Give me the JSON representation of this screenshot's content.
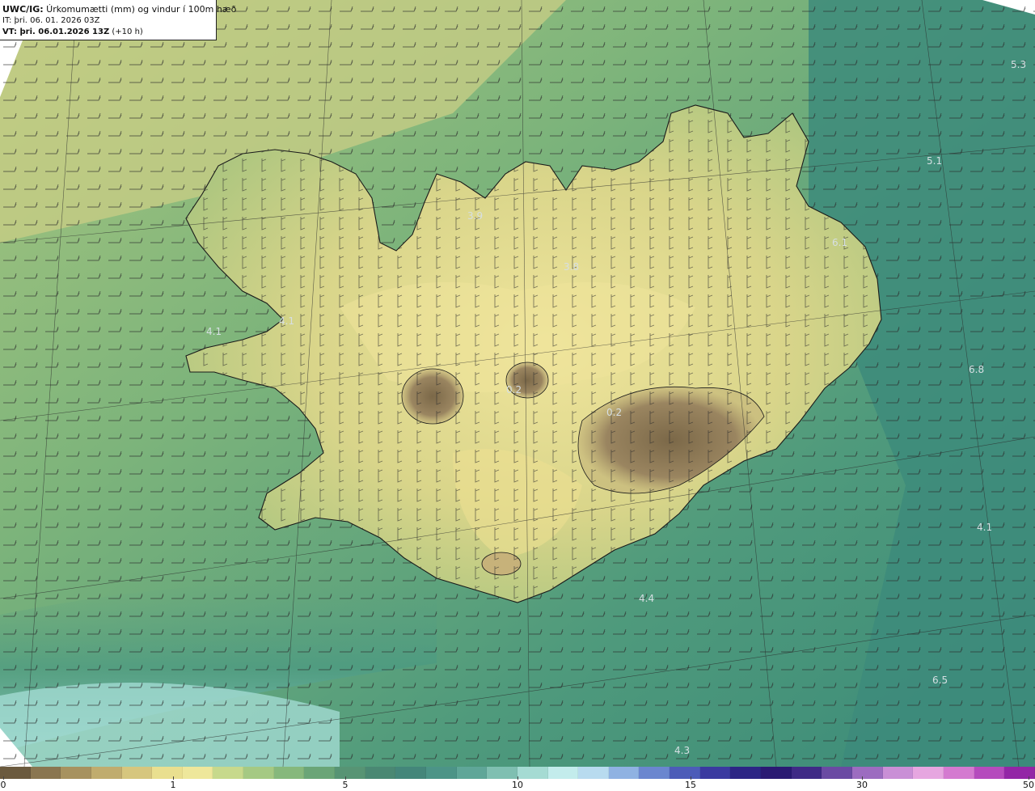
{
  "header": {
    "product_bold": "UWC/IG:",
    "product_rest": " Úrkomumætti (mm) og vindur í 100m hæð",
    "init_time": "IT: þri. 06. 01. 2026 03Z",
    "valid_label": "VT: þri. 06.01.2026 13Z",
    "valid_offset": "(+10 h)"
  },
  "map_values": [
    {
      "label": "5.3"
    },
    {
      "label": "5.1"
    },
    {
      "label": "3.9"
    },
    {
      "label": "6.1"
    },
    {
      "label": "3.8"
    },
    {
      "label": "4.1"
    },
    {
      "label": "4.1"
    },
    {
      "label": "0.2"
    },
    {
      "label": "0.2"
    },
    {
      "label": "6.8"
    },
    {
      "label": "4.1"
    },
    {
      "label": "4.4"
    },
    {
      "label": "6.5"
    },
    {
      "label": "4.3"
    }
  ],
  "colorbar": {
    "ticks": [
      "0",
      "1",
      "5",
      "10",
      "15",
      "30",
      "50"
    ],
    "colors": [
      "#6b5a3e",
      "#8a7650",
      "#a7925f",
      "#c0ac6e",
      "#d6c67e",
      "#e9df8f",
      "#eee79b",
      "#c7d98c",
      "#a5c983",
      "#86b87c",
      "#6aa577",
      "#579474",
      "#4a8873",
      "#44867a",
      "#4c9487",
      "#5fa698",
      "#7fbfb1",
      "#a5dbd3",
      "#c3ecec",
      "#b8dbef",
      "#8fb2e2",
      "#6a86cf",
      "#4c5cb8",
      "#3a3aa0",
      "#2c2585",
      "#2a1a73",
      "#3f2a86",
      "#6a4aa3",
      "#9c6cc0",
      "#c98fd6",
      "#e6a6e0",
      "#d47ad0",
      "#b54bbd",
      "#9326a6"
    ]
  },
  "colors": {
    "land_low": "#c9cc86",
    "land_high": "#ece296",
    "ice_brown": "#8a7652",
    "sea_green": "#3f8f7a",
    "sea_light": "#9fd7cf"
  }
}
